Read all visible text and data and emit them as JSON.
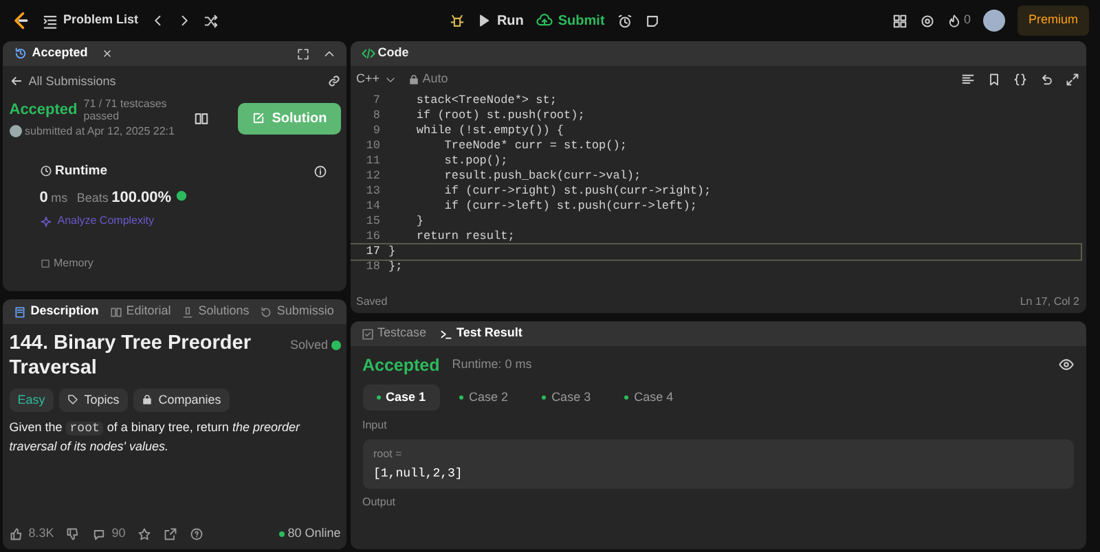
{
  "topbar": {
    "title": "Problem List",
    "run": "Run",
    "submit": "Submit",
    "streak": "0",
    "premium": "Premium"
  },
  "submission_panel": {
    "tab": "Accepted",
    "back": "All Submissions",
    "status": "Accepted",
    "testcases": "71 / 71 testcases passed",
    "submitted": "submitted at Apr 12, 2025 22:1",
    "solution_button": "Solution",
    "runtime_label": "Runtime",
    "runtime_value": "0",
    "runtime_unit": "ms",
    "beats_label": "Beats",
    "beats_value": "100.00%",
    "analyze": "Analyze Complexity",
    "memory_label": "Memory"
  },
  "description_panel": {
    "tabs": [
      {
        "label": "Description",
        "selected": true
      },
      {
        "label": "Editorial",
        "selected": false
      },
      {
        "label": "Solutions",
        "selected": false
      },
      {
        "label": "Submissio",
        "selected": false
      }
    ],
    "title": "144. Binary Tree Preorder Traversal",
    "solved": "Solved",
    "difficulty": "Easy",
    "topics": "Topics",
    "companies": "Companies",
    "description": {
      "before": "Given the",
      "code": "root",
      "after": "of a binary tree, return *the preorder traversal of its nodes' values.*"
    },
    "likes": "8.3K",
    "comments": "90",
    "online": "80 Online"
  },
  "code_panel": {
    "title": "Code",
    "language": "C++",
    "mode": "Auto",
    "lines": [
      {
        "number": "7",
        "text": "    stack<TreeNode*> st;",
        "current": false
      },
      {
        "number": "8",
        "text": "    if (root) st.push(root);",
        "current": false
      },
      {
        "number": "9",
        "text": "    while (!st.empty()) {",
        "current": false
      },
      {
        "number": "10",
        "text": "        TreeNode* curr = st.top();",
        "current": false
      },
      {
        "number": "11",
        "text": "        st.pop();",
        "current": false
      },
      {
        "number": "12",
        "text": "        result.push_back(curr->val);",
        "current": false
      },
      {
        "number": "13",
        "text": "        if (curr->right) st.push(curr->right);",
        "current": false
      },
      {
        "number": "14",
        "text": "        if (curr->left) st.push(curr->left);",
        "current": false
      },
      {
        "number": "15",
        "text": "    }",
        "current": false
      },
      {
        "number": "16",
        "text": "    return result;",
        "current": false
      },
      {
        "number": "17",
        "text": "}",
        "current": true
      },
      {
        "number": "18",
        "text": "};",
        "current": false
      }
    ],
    "status": "Saved",
    "cursor": "Ln 17, Col 2"
  },
  "result_panel": {
    "tabs": [
      {
        "label": "Testcase",
        "selected": false
      },
      {
        "label": "Test Result",
        "selected": true
      }
    ],
    "status": "Accepted",
    "runtime": "Runtime: 0 ms",
    "cases": [
      {
        "label": "Case 1",
        "selected": true
      },
      {
        "label": "Case 2",
        "selected": false
      },
      {
        "label": "Case 3",
        "selected": false
      },
      {
        "label": "Case 4",
        "selected": false
      }
    ],
    "input_label": "Input",
    "param": "root =",
    "value": "[1,null,2,3]",
    "output_label": "Output"
  }
}
